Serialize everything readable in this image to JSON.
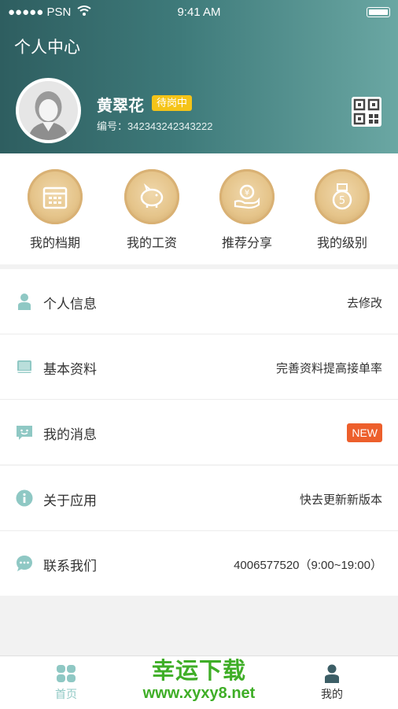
{
  "status_bar": {
    "carrier": "●●●●● PSN",
    "time": "9:41 AM"
  },
  "header": {
    "title": "个人中心"
  },
  "profile": {
    "name": "黄翠花",
    "badge": "待岗中",
    "id_label": "编号：342343242343222"
  },
  "quick_actions": [
    {
      "label": "我的档期",
      "icon": "calendar-icon"
    },
    {
      "label": "我的工资",
      "icon": "piggy-bank-icon"
    },
    {
      "label": "推荐分享",
      "icon": "coin-hand-icon"
    },
    {
      "label": "我的级别",
      "icon": "medal-icon"
    }
  ],
  "menu1": [
    {
      "label": "个人信息",
      "value": "去修改",
      "icon": "person-icon"
    },
    {
      "label": "基本资料",
      "value": "完善资料提高接单率",
      "icon": "book-icon"
    },
    {
      "label": "我的消息",
      "value": "NEW",
      "icon": "message-icon"
    }
  ],
  "menu2": [
    {
      "label": "关于应用",
      "value": "快去更新新版本",
      "icon": "info-icon"
    },
    {
      "label": "联系我们",
      "value": "4006577520（9:00~19:00）",
      "icon": "chat-icon"
    }
  ],
  "tabbar": [
    {
      "label": "首页",
      "icon": "home-grid-icon",
      "color": "#8fc8c4"
    },
    {
      "label": "我的",
      "icon": "user-icon",
      "color": "#333333"
    }
  ],
  "watermark": {
    "line1": "幸运下载",
    "line2": "www.xyxy8.net"
  },
  "colors": {
    "accent_teal": "#3e7a7a",
    "gold": "#e5c48a",
    "badge_yellow": "#f5c418",
    "new_orange": "#ed5f2c",
    "icon_teal": "#8fc8c4"
  }
}
